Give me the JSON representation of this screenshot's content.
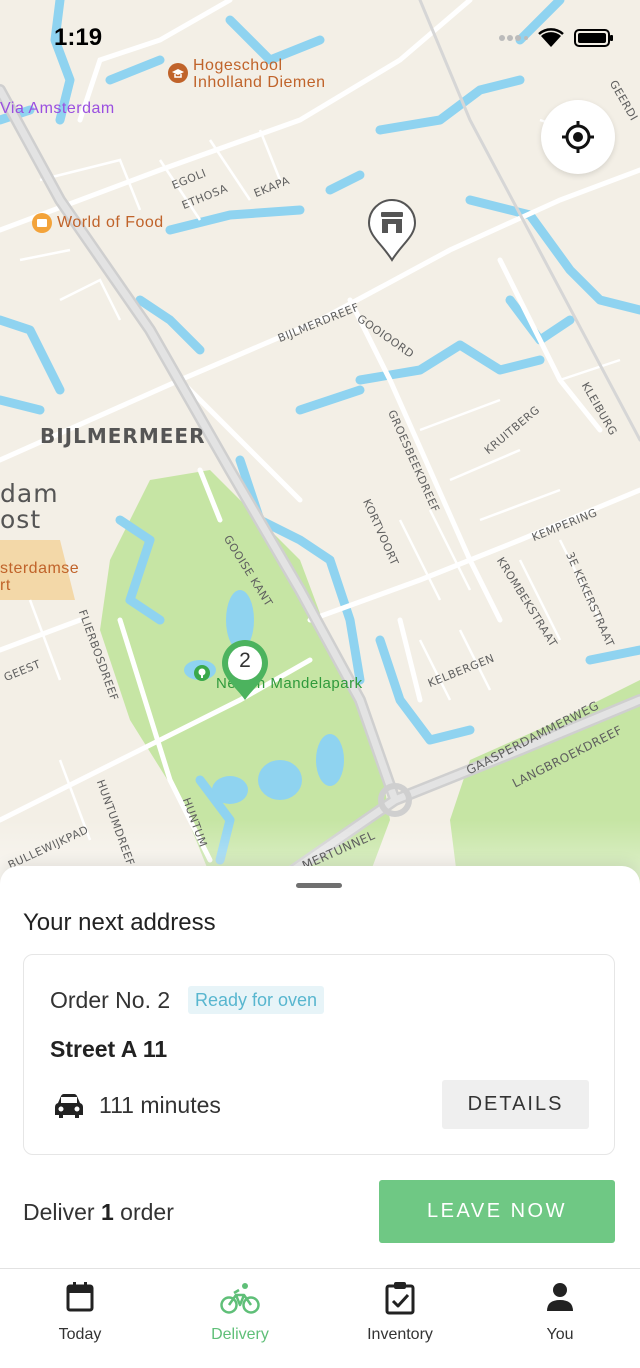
{
  "status_bar": {
    "time": "1:19"
  },
  "map": {
    "labels": {
      "hogeschool_line1": "Hogeschool",
      "hogeschool_line2": "Inholland Diemen",
      "via_amsterdam": "Via Amsterdam",
      "world_of_food": "World of Food",
      "egoli": "EGOLI",
      "ethosa": "ETHOSA",
      "ekapa": "EKAPA",
      "bijlmerdreef": "BIJLMERDREEF",
      "gooioord": "GOOIOORD",
      "bijlmermeer": "BIJLMERMEER",
      "dam_oost": "dam\nost",
      "amsterdamse": "sterdamse\nrt",
      "groesbeekdreef": "GROESBEEKDREEF",
      "kruitberg": "KRUITBERG",
      "kleiburg": "KLEIBURG",
      "kortvoort": "KORTVOORT",
      "kempering": "KEMPERING",
      "gooise_kant": "GOOISE KANT",
      "krombekstraat": "KROMBEKSTRAAT",
      "kekerstraat": "3E KEKERSTRAAT",
      "flierbosdreef": "FLIERBOSDREEF",
      "geest": "GEEST",
      "park": "Nelson Mandelapark",
      "kelbergen": "KELBERGEN",
      "gaasperdammerweg": "GAASPERDAMMERWEG",
      "langbroekdreef": "LANGBROEKDREEF",
      "huntumdreef": "HUNTUMDREEF",
      "huntum": "HUNTUM",
      "bullewijkpad": "BULLEWIJKPAD",
      "mertunnel": "MERTUNNEL",
      "geerdinge": "GEERDI"
    },
    "cluster_count": "2"
  },
  "sheet": {
    "title": "Your next address",
    "order": {
      "number_label": "Order No. 2",
      "status": "Ready for oven",
      "address": "Street A 11",
      "eta": "111 minutes",
      "details_label": "DETAILS"
    },
    "deliver_prefix": "Deliver",
    "deliver_count": "1",
    "deliver_suffix": "order",
    "leave_label": "LEAVE NOW"
  },
  "tabs": [
    {
      "label": "Today",
      "icon": "calendar-icon"
    },
    {
      "label": "Delivery",
      "icon": "bicycle-icon"
    },
    {
      "label": "Inventory",
      "icon": "clipboard-check-icon"
    },
    {
      "label": "You",
      "icon": "person-icon"
    }
  ],
  "colors": {
    "accent_green": "#6fc884",
    "badge_blue": "#58b6cf",
    "water": "#8fd3f0",
    "park": "#c6e5a4"
  }
}
